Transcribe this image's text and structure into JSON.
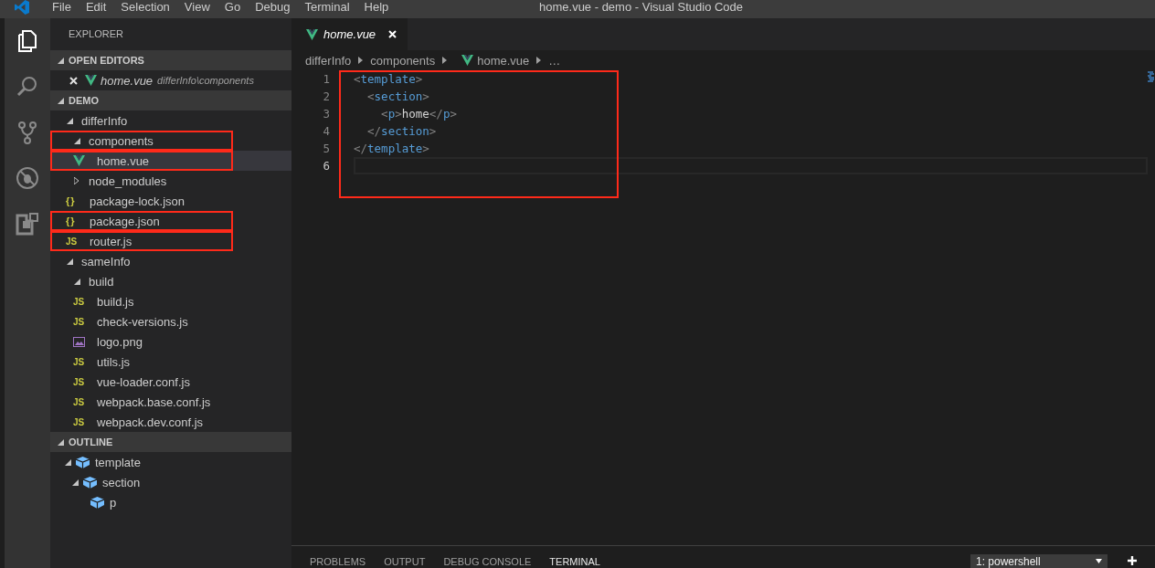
{
  "menu": [
    {
      "label": "File"
    },
    {
      "label": "Edit"
    },
    {
      "label": "Selection"
    },
    {
      "label": "View"
    },
    {
      "label": "Go"
    },
    {
      "label": "Debug"
    },
    {
      "label": "Terminal"
    },
    {
      "label": "Help"
    }
  ],
  "window": {
    "title": "home.vue - demo - Visual Studio Code"
  },
  "activity_bar": [
    {
      "kind": "files",
      "selected": true
    },
    {
      "kind": "search",
      "selected": false
    },
    {
      "kind": "scm",
      "selected": false
    },
    {
      "kind": "debug",
      "selected": false
    },
    {
      "kind": "extensions",
      "selected": false
    }
  ],
  "sidebar": {
    "title": "EXPLORER",
    "open_editors": {
      "label": "OPEN EDITORS",
      "expanded": true,
      "items": [
        {
          "name": "home.vue",
          "path": "differInfo\\components",
          "kind": "vue"
        }
      ]
    },
    "project": {
      "label": "DEMO",
      "expanded": true,
      "tree": [
        {
          "name": "differInfo",
          "kind": "folder",
          "expanded": true,
          "selected": false,
          "boxed": false,
          "children": [
            {
              "name": "components",
              "kind": "folder",
              "expanded": true,
              "selected": false,
              "boxed": true,
              "children": [
                {
                  "name": "home.vue",
                  "kind": "vue",
                  "selected": true,
                  "boxed": true
                }
              ]
            },
            {
              "name": "node_modules",
              "kind": "folder",
              "expanded": false,
              "selected": false,
              "boxed": false
            },
            {
              "name": "package-lock.json",
              "kind": "json",
              "icon": "{ }",
              "selected": false,
              "boxed": false
            },
            {
              "name": "package.json",
              "kind": "json",
              "icon": "{ }",
              "selected": false,
              "boxed": true
            },
            {
              "name": "router.js",
              "kind": "js",
              "icon": "JS",
              "selected": false,
              "boxed": true
            }
          ]
        },
        {
          "name": "sameInfo",
          "kind": "folder",
          "expanded": true,
          "selected": false,
          "boxed": false,
          "children": [
            {
              "name": "build",
              "kind": "folder",
              "expanded": true,
              "selected": false,
              "boxed": false,
              "children": [
                {
                  "name": "build.js",
                  "kind": "js",
                  "icon": "JS",
                  "selected": false,
                  "boxed": false
                },
                {
                  "name": "check-versions.js",
                  "kind": "js",
                  "icon": "JS",
                  "selected": false,
                  "boxed": false
                },
                {
                  "name": "logo.png",
                  "kind": "image",
                  "selected": false,
                  "boxed": false
                },
                {
                  "name": "utils.js",
                  "kind": "js",
                  "icon": "JS",
                  "selected": false,
                  "boxed": false
                },
                {
                  "name": "vue-loader.conf.js",
                  "kind": "js",
                  "icon": "JS",
                  "selected": false,
                  "boxed": false
                },
                {
                  "name": "webpack.base.conf.js",
                  "kind": "js",
                  "icon": "JS",
                  "selected": false,
                  "boxed": false
                },
                {
                  "name": "webpack.dev.conf.js",
                  "kind": "js",
                  "icon": "JS",
                  "selected": false,
                  "boxed": false
                }
              ]
            }
          ]
        }
      ]
    },
    "outline": {
      "label": "OUTLINE",
      "expanded": true,
      "tree": [
        {
          "name": "template",
          "expanded": true,
          "children": [
            {
              "name": "section",
              "expanded": true,
              "children": [
                {
                  "name": "p"
                }
              ]
            }
          ]
        }
      ]
    }
  },
  "editor": {
    "tabs": [
      {
        "label": "home.vue",
        "kind": "vue",
        "selected": true,
        "preview": true
      }
    ],
    "breadcrumbs": [
      {
        "label": "differInfo",
        "kind": "folder"
      },
      {
        "label": "components",
        "kind": "folder"
      },
      {
        "label": "home.vue",
        "kind": "vue"
      },
      {
        "label": "…",
        "kind": "more"
      }
    ],
    "boxed": true,
    "lines": [
      {
        "number": "1",
        "current": false,
        "tokens": [
          {
            "kind": "punct",
            "text": "<"
          },
          {
            "kind": "tag",
            "text": "template"
          },
          {
            "kind": "punct",
            "text": ">"
          }
        ]
      },
      {
        "number": "2",
        "current": false,
        "tokens": [
          {
            "kind": "punct",
            "text": "  <"
          },
          {
            "kind": "tag",
            "text": "section"
          },
          {
            "kind": "punct",
            "text": ">"
          }
        ]
      },
      {
        "number": "3",
        "current": false,
        "tokens": [
          {
            "kind": "punct",
            "text": "    <"
          },
          {
            "kind": "tag",
            "text": "p"
          },
          {
            "kind": "punct",
            "text": ">"
          },
          {
            "kind": "text",
            "text": "home"
          },
          {
            "kind": "punct",
            "text": "</"
          },
          {
            "kind": "tag",
            "text": "p"
          },
          {
            "kind": "punct",
            "text": ">"
          }
        ]
      },
      {
        "number": "4",
        "current": false,
        "tokens": [
          {
            "kind": "punct",
            "text": "  </"
          },
          {
            "kind": "tag",
            "text": "section"
          },
          {
            "kind": "punct",
            "text": ">"
          }
        ]
      },
      {
        "number": "5",
        "current": false,
        "tokens": [
          {
            "kind": "punct",
            "text": "</"
          },
          {
            "kind": "tag",
            "text": "template"
          },
          {
            "kind": "punct",
            "text": ">"
          }
        ]
      },
      {
        "number": "6",
        "current": true
      }
    ]
  },
  "panel": {
    "tabs": [
      {
        "label": "PROBLEMS",
        "selected": false
      },
      {
        "label": "OUTPUT",
        "selected": false
      },
      {
        "label": "DEBUG CONSOLE",
        "selected": false
      },
      {
        "label": "TERMINAL",
        "selected": true
      }
    ],
    "terminal_select": {
      "value": "1: powershell"
    }
  }
}
